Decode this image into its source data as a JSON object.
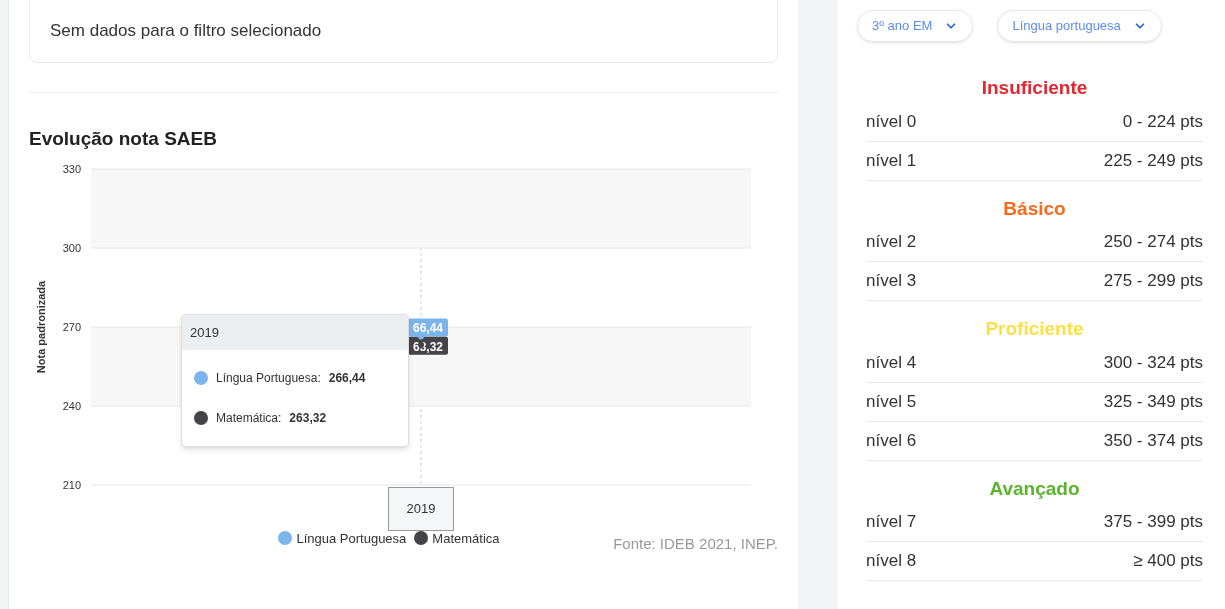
{
  "notice": {
    "text": "Sem dados para o filtro selecionado"
  },
  "chart_section": {
    "title": "Evolução nota SAEB",
    "chart_data": {
      "type": "line",
      "ylabel": "Nota padronizada",
      "categories": [
        "2019"
      ],
      "ylim": [
        210,
        330
      ],
      "yticks": [
        210,
        240,
        270,
        300,
        330
      ],
      "grid": true,
      "legend": true,
      "value_labels": [
        [
          "66,44"
        ],
        [
          "63,32"
        ]
      ],
      "series": [
        {
          "name": "Língua Portuguesa",
          "color": "#7cb5ec",
          "marker": "circle",
          "values": [
            266.4
          ]
        },
        {
          "name": "Matemática",
          "color": "#434348",
          "marker": "circle",
          "values": [
            263.3
          ]
        }
      ]
    },
    "tooltip": {
      "title": "2019",
      "rows": [
        {
          "label": "Língua Portuguesa:",
          "value": "266,44",
          "color": "#7cb5ec"
        },
        {
          "label": "Matemática:",
          "value": "263,32",
          "color": "#434348"
        }
      ]
    },
    "source": "Fonte: IDEB 2021, INEP."
  },
  "filters": [
    {
      "value": "3º ano EM"
    },
    {
      "value": "Língua portuguesa"
    }
  ],
  "level_groups": [
    {
      "title": "Insuficiente",
      "color": "#e5262f",
      "levels": [
        {
          "name": "nível 0",
          "range": "0 - 224 pts"
        },
        {
          "name": "nível 1",
          "range": "225 - 249 pts"
        }
      ]
    },
    {
      "title": "Básico",
      "color": "#f96a1c",
      "levels": [
        {
          "name": "nível 2",
          "range": "250 - 274 pts"
        },
        {
          "name": "nível 3",
          "range": "275 - 299 pts"
        }
      ]
    },
    {
      "title": "Proficiente",
      "color": "#fde047",
      "levels": [
        {
          "name": "nível 4",
          "range": "300 - 324 pts"
        },
        {
          "name": "nível 5",
          "range": "325 - 349 pts"
        },
        {
          "name": "nível 6",
          "range": "350 - 374 pts"
        }
      ]
    },
    {
      "title": "Avançado",
      "color": "#5bb52c",
      "levels": [
        {
          "name": "nível 7",
          "range": "375 - 399 pts"
        },
        {
          "name": "nível 8",
          "range": "≥ 400 pts"
        }
      ]
    }
  ]
}
